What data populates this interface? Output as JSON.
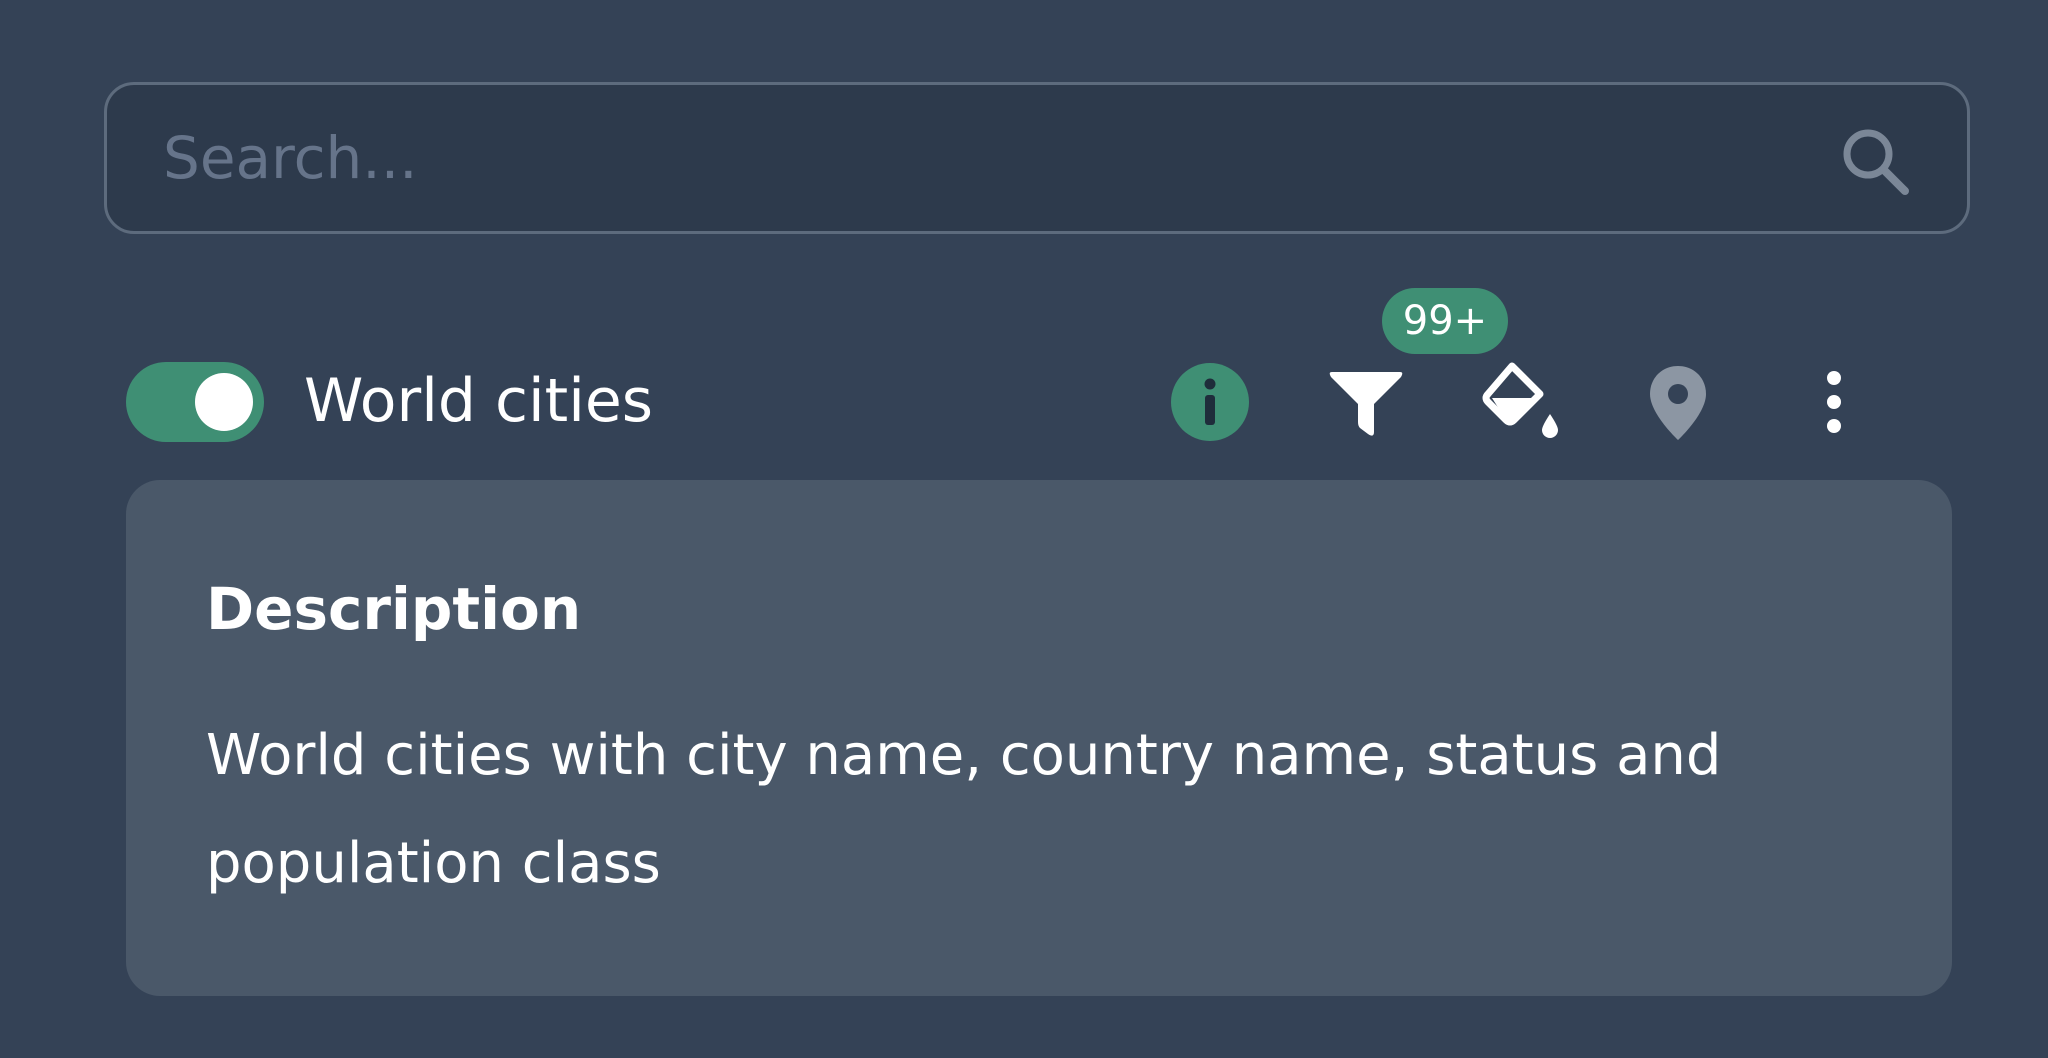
{
  "search": {
    "placeholder": "Search...",
    "value": "",
    "icon": "search-icon"
  },
  "layer": {
    "title": "World cities",
    "enabled": true,
    "toggle_color": "#3f8f74",
    "actions": {
      "info_icon": "info-icon",
      "filter_icon": "filter-icon",
      "style_icon": "paint-bucket-icon",
      "zoom_icon": "map-pin-icon",
      "more_icon": "more-vertical-icon"
    },
    "filter_badge": "99+"
  },
  "description": {
    "heading": "Description",
    "text": "World cities with city name, country name, status and population class"
  },
  "colors": {
    "background": "#344256",
    "accent": "#3f8f74",
    "card": "#4a5869",
    "muted_icon": "#8c96a3"
  }
}
